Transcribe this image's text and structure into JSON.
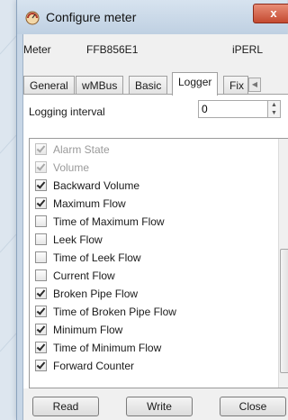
{
  "window": {
    "title": "Configure meter",
    "icon": "meter-app-icon",
    "close_label": "x"
  },
  "meter": {
    "label": "Meter",
    "id": "FFB856E1",
    "type": "iPERL"
  },
  "tabs": [
    {
      "label": "General",
      "active": false
    },
    {
      "label": "wMBus",
      "active": false
    },
    {
      "label": "Basic",
      "active": false
    },
    {
      "label": "Logger",
      "active": true
    },
    {
      "label": "Fix",
      "active": false
    }
  ],
  "logger": {
    "interval_label": "Logging interval",
    "interval_value": "0",
    "items": [
      {
        "label": "Alarm State",
        "checked": true,
        "enabled": false
      },
      {
        "label": "Volume",
        "checked": true,
        "enabled": false
      },
      {
        "label": "Backward Volume",
        "checked": true,
        "enabled": true
      },
      {
        "label": "Maximum Flow",
        "checked": true,
        "enabled": true
      },
      {
        "label": "Time of Maximum Flow",
        "checked": false,
        "enabled": true
      },
      {
        "label": "Leek Flow",
        "checked": false,
        "enabled": true
      },
      {
        "label": "Time of Leek Flow",
        "checked": false,
        "enabled": true
      },
      {
        "label": "Current Flow",
        "checked": false,
        "enabled": true
      },
      {
        "label": "Broken Pipe Flow",
        "checked": true,
        "enabled": true
      },
      {
        "label": "Time of Broken Pipe Flow",
        "checked": true,
        "enabled": true
      },
      {
        "label": "Minimum Flow",
        "checked": true,
        "enabled": true
      },
      {
        "label": "Time of Minimum Flow",
        "checked": true,
        "enabled": true
      },
      {
        "label": "Forward Counter",
        "checked": true,
        "enabled": true
      }
    ]
  },
  "buttons": {
    "read": "Read",
    "write": "Write",
    "close": "Close"
  },
  "colors": {
    "titlebar": "#c7d6e6",
    "close_button": "#c44a30",
    "panel": "#ffffff"
  }
}
